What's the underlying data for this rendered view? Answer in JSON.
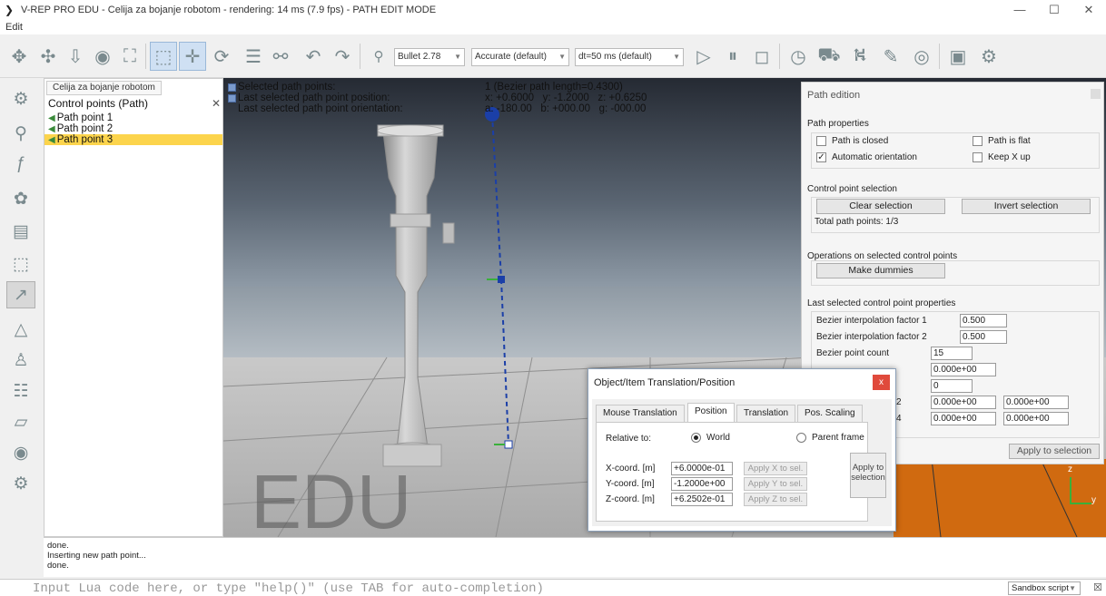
{
  "window": {
    "title": "V-REP PRO EDU - Celija za bojanje robotom - rendering: 14 ms (7.9 fps) - PATH EDIT MODE",
    "minimize": "—",
    "maximize": "☐",
    "close": "✕"
  },
  "menu": {
    "edit": "Edit"
  },
  "toolbar": {
    "engine": "Bullet 2.78",
    "accuracy": "Accurate (default)",
    "timestep": "dt=50 ms (default)"
  },
  "hierarchy": {
    "tab": "Celija za bojanje robotom",
    "header": "Control points (Path)",
    "items": [
      "Path point 1",
      "Path point 2",
      "Path point 3"
    ],
    "selected_index": 2
  },
  "viewport": {
    "info_labels": [
      "Selected path points:",
      "Last selected path point position:",
      "Last selected path point orientation:"
    ],
    "info_values": [
      "1 (Bezier path length=0.4300)",
      "x: +0.6000   y: -1.2000   z: +0.6250",
      "a: -180.00   b: +000.00   g: -000.00"
    ],
    "watermark": "EDU",
    "axis_z": "z",
    "axis_y": "y"
  },
  "path_edition": {
    "title": "Path edition",
    "path_properties_label": "Path properties",
    "path_is_closed": "Path is closed",
    "path_is_flat": "Path is flat",
    "automatic_orientation": "Automatic orientation",
    "keep_x_up": "Keep X up",
    "automatic_orientation_checked": true,
    "control_point_selection_label": "Control point selection",
    "clear_selection": "Clear selection",
    "invert_selection": "Invert selection",
    "total_points": "Total path points: 1/3",
    "operations_label": "Operations on selected control points",
    "make_dummies": "Make dummies",
    "last_props_label": "Last selected control point properties",
    "bezier_factor_1_label": "Bezier interpolation factor 1",
    "bezier_factor_1": "0.500",
    "bezier_factor_2_label": "Bezier interpolation factor 2",
    "bezier_factor_2": "0.500",
    "bezier_point_count_label": "Bezier point count",
    "bezier_point_count": "15",
    "virtual_distance": "0.000e+00",
    "aux_flags": "0",
    "aux_channel_a1": "0.000e+00",
    "aux_channel_a2": "0.000e+00",
    "aux_channel_b1": "0.000e+00",
    "aux_channel_b2": "0.000e+00",
    "aux_label_1_suffix": "2",
    "aux_label_2_suffix": "4",
    "apply_to_selection": "Apply to selection"
  },
  "translation_dialog": {
    "title": "Object/Item Translation/Position",
    "close_icon": "x",
    "tabs": [
      "Mouse Translation",
      "Position",
      "Translation",
      "Pos. Scaling"
    ],
    "active_tab": 1,
    "relative_to": "Relative to:",
    "world": "World",
    "parent_frame": "Parent frame",
    "x_label": "X-coord. [m]",
    "y_label": "Y-coord. [m]",
    "z_label": "Z-coord. [m]",
    "x_value": "+6.0000e-01",
    "y_value": "-1.2000e+00",
    "z_value": "+6.2502e-01",
    "apply_x": "Apply X to sel.",
    "apply_y": "Apply Y to sel.",
    "apply_z": "Apply Z to sel.",
    "apply_to_selection": "Apply to selection"
  },
  "status": {
    "lines": [
      "done.",
      "Inserting new path point...",
      "done."
    ]
  },
  "lua": {
    "placeholder": "Input Lua code here, or type \"help()\" (use TAB for auto-completion)",
    "script_select": "Sandbox script",
    "close": "☒"
  },
  "colors": {
    "selection": "#fcd44c",
    "viewport_top": "#2f3440",
    "floor": "#c8c8c8",
    "object": "#b8b8b8",
    "path": "#1b3fa8",
    "dialog_close": "#e04a3c"
  }
}
